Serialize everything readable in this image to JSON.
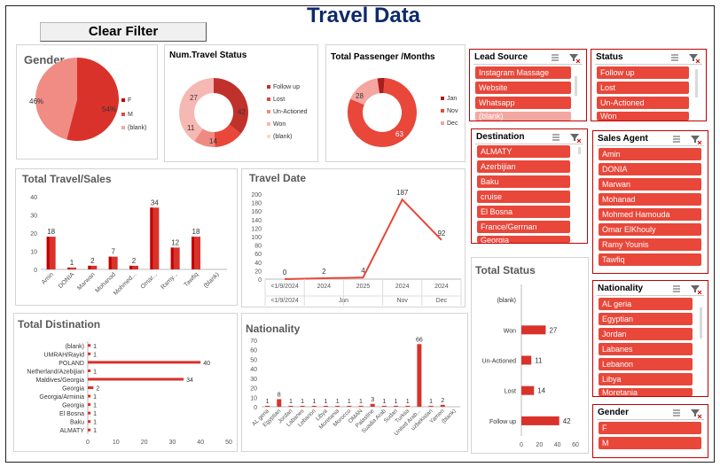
{
  "title": "Travel Data",
  "clear_filter": "Clear Filter",
  "colors": {
    "red": "#d9322b",
    "dark_red": "#c00000",
    "pink": "#f4a6a0",
    "title": "#0e2a6b"
  },
  "gender_chart": {
    "title": "Gender",
    "labels": {
      "f": "54%",
      "m": "46%"
    },
    "legend": [
      "F",
      "M",
      "(blank)"
    ]
  },
  "num_travel_status": {
    "title": "Num.Travel Status",
    "values": {
      "follow_up": "42",
      "lost": "14",
      "unactioned": "11",
      "won": "27"
    },
    "legend": [
      "Follow up",
      "Lost",
      "Un-Actioned",
      "Won",
      "(blank)"
    ]
  },
  "total_passenger": {
    "title": "Total Passenger /Months",
    "values": {
      "nov": "63",
      "dec": "28"
    },
    "legend": [
      "Jan",
      "Nov",
      "Dec"
    ]
  },
  "chart_data": [
    {
      "type": "bar",
      "title": "Total Travel/Sales",
      "categories": [
        "Amin",
        "DONIA",
        "Marwan",
        "Mohanad",
        "Mohmed...",
        "Omar...",
        "Ramy...",
        "Tawfiq",
        "(blank)"
      ],
      "values": [
        18,
        1,
        2,
        7,
        2,
        34,
        12,
        18,
        null
      ],
      "data_labels": [
        "18",
        "1",
        "2",
        "7",
        "2",
        "34",
        "12",
        "18"
      ],
      "y_ticks": [
        "40",
        "30",
        "20",
        "10",
        "0"
      ],
      "ylim": [
        0,
        40
      ]
    },
    {
      "type": "line",
      "title": "Travel Date",
      "x_top": [
        "<1/9/2024",
        "2024",
        "2025",
        "2024",
        "2024"
      ],
      "x_bottom": [
        "<1/9/2024",
        "Jan",
        "Nov",
        "Dec"
      ],
      "values": [
        0,
        2,
        4,
        187,
        92
      ],
      "data_labels": [
        "0",
        "2",
        "4",
        "187",
        "92"
      ],
      "y_ticks": [
        "200",
        "180",
        "160",
        "140",
        "120",
        "100",
        "80",
        "60",
        "40",
        "20",
        "0"
      ],
      "ylim": [
        0,
        200
      ]
    },
    {
      "type": "bar",
      "title": "Total Distination",
      "categories": [
        "(blank)",
        "UMRAH/Rayid",
        "POLAND",
        "Netherland/Azebijian",
        "Maldives/Georgia",
        "Georgia",
        "Georgia/Arminia",
        "Georgia",
        "El Bosna",
        "Baku",
        "ALMATY"
      ],
      "values": [
        1,
        1,
        40,
        1,
        34,
        2,
        1,
        1,
        1,
        1,
        1
      ],
      "data_labels": [
        "1",
        "1",
        "40",
        "1",
        "34",
        "2",
        "1",
        "1",
        "1",
        "1",
        "1"
      ],
      "x_ticks": [
        "0",
        "10",
        "20",
        "30",
        "40",
        "50"
      ],
      "xlim": [
        0,
        50
      ]
    },
    {
      "type": "bar",
      "title": "Nationality",
      "categories": [
        "AL geria",
        "Egyptian",
        "Jordan",
        "Labanes",
        "Lebanon",
        "Libya",
        "Moretania",
        "Morocco",
        "OMAN",
        "Palastine",
        "Suadia Arab",
        "Sudan",
        "Turkiia",
        "United Arab...",
        "uzbekistan",
        "Yamen",
        "(blank)"
      ],
      "values": [
        1,
        8,
        1,
        1,
        1,
        1,
        1,
        1,
        1,
        3,
        1,
        1,
        1,
        66,
        1,
        2,
        null
      ],
      "data_labels": [
        "1",
        "8",
        "1",
        "1",
        "1",
        "1",
        "1",
        "1",
        "1",
        "3",
        "1",
        "1",
        "1",
        "66",
        "1",
        "2"
      ],
      "y_ticks": [
        "70",
        "60",
        "50",
        "40",
        "30",
        "20",
        "10",
        "0"
      ],
      "ylim": [
        0,
        70
      ]
    },
    {
      "type": "bar",
      "title": "Total Status",
      "categories": [
        "(blank)",
        "Won",
        "Un-Actioned",
        "Lost",
        "Follow up"
      ],
      "values": [
        null,
        27,
        11,
        14,
        42
      ],
      "data_labels": [
        "",
        "27",
        "11",
        "14",
        "42"
      ],
      "x_ticks": [
        "0",
        "20",
        "40",
        "60"
      ],
      "xlim": [
        0,
        60
      ]
    }
  ],
  "slicers": {
    "lead_source": {
      "title": "Lead Source",
      "items": [
        "Instagram Massage",
        "Website",
        "Whatsapp",
        "(blank)"
      ]
    },
    "status": {
      "title": "Status",
      "items": [
        "Follow up",
        "Lost",
        "Un-Actioned",
        "Won"
      ]
    },
    "destination": {
      "title": "Destination",
      "items": [
        "ALMATY",
        "Azerbijian",
        "Baku",
        "cruise",
        "El Bosna",
        "France/Gerrnan",
        "Georgia"
      ]
    },
    "sales_agent": {
      "title": "Sales Agent",
      "items": [
        "Amin",
        "DONIA",
        "Marwan",
        "Mohanad",
        "Mohmed Hamouda",
        "Omar ElKhouly",
        "Ramy Younis",
        "Tawfiq"
      ]
    },
    "nationality": {
      "title": "Nationality",
      "items": [
        "AL geria",
        "Egyptian",
        "Jordan",
        "Labanes",
        "Lebanon",
        "Libya",
        "Moretania"
      ]
    },
    "gender": {
      "title": "Gender",
      "items": [
        "F",
        "M"
      ]
    }
  }
}
